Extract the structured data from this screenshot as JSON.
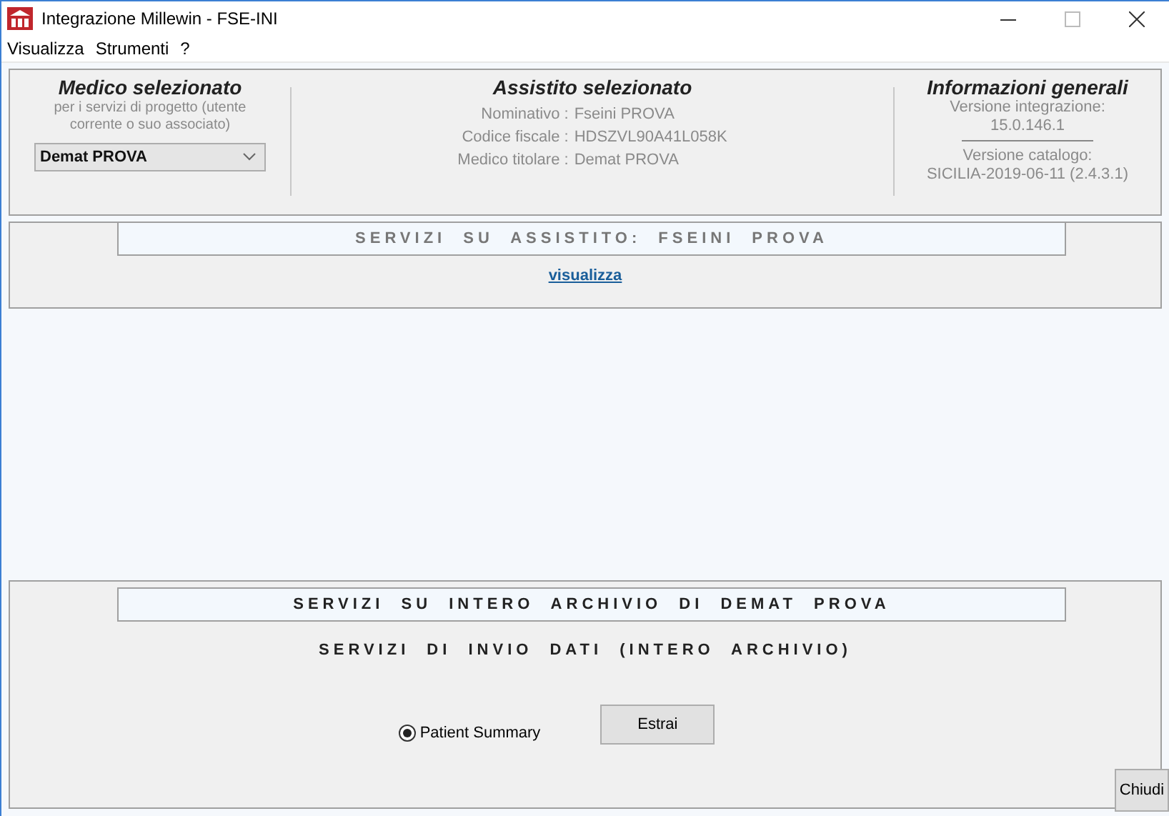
{
  "window": {
    "title": "Integrazione Millewin - FSE-INI"
  },
  "menu": [
    "Visualizza",
    "Strumenti",
    "?"
  ],
  "medico": {
    "heading": "Medico selezionato",
    "note": "per i servizi di progetto (utente corrente o suo associato)",
    "dropdown_value": "Demat PROVA"
  },
  "assistito": {
    "heading": "Assistito selezionato",
    "fields": [
      {
        "label": "Nominativo :",
        "value": "Fseini PROVA"
      },
      {
        "label": "Codice fiscale :",
        "value": "HDSZVL90A41L058K"
      },
      {
        "label": "Medico titolare :",
        "value": "Demat PROVA"
      }
    ]
  },
  "informazioni": {
    "heading": "Informazioni generali",
    "items": [
      {
        "label": "Versione integrazione:",
        "value": "15.0.146.1"
      },
      {
        "label": "Versione catalogo:",
        "value": "SICILIA-2019-06-11 (2.4.3.1)"
      }
    ]
  },
  "servizi_assistito": {
    "heading": "SERVIZI SU ASSISTITO: FSEINI PROVA",
    "link": "visualizza"
  },
  "servizi_archivio": {
    "heading": "SERVIZI SU INTERO ARCHIVIO DI DEMAT PROVA",
    "subheading": "SERVIZI DI INVIO DATI (INTERO ARCHIVIO)",
    "options": [
      {
        "label": "Patient Summary",
        "selected": true
      }
    ],
    "button": "Estrai"
  },
  "close_button": "Chiudi"
}
